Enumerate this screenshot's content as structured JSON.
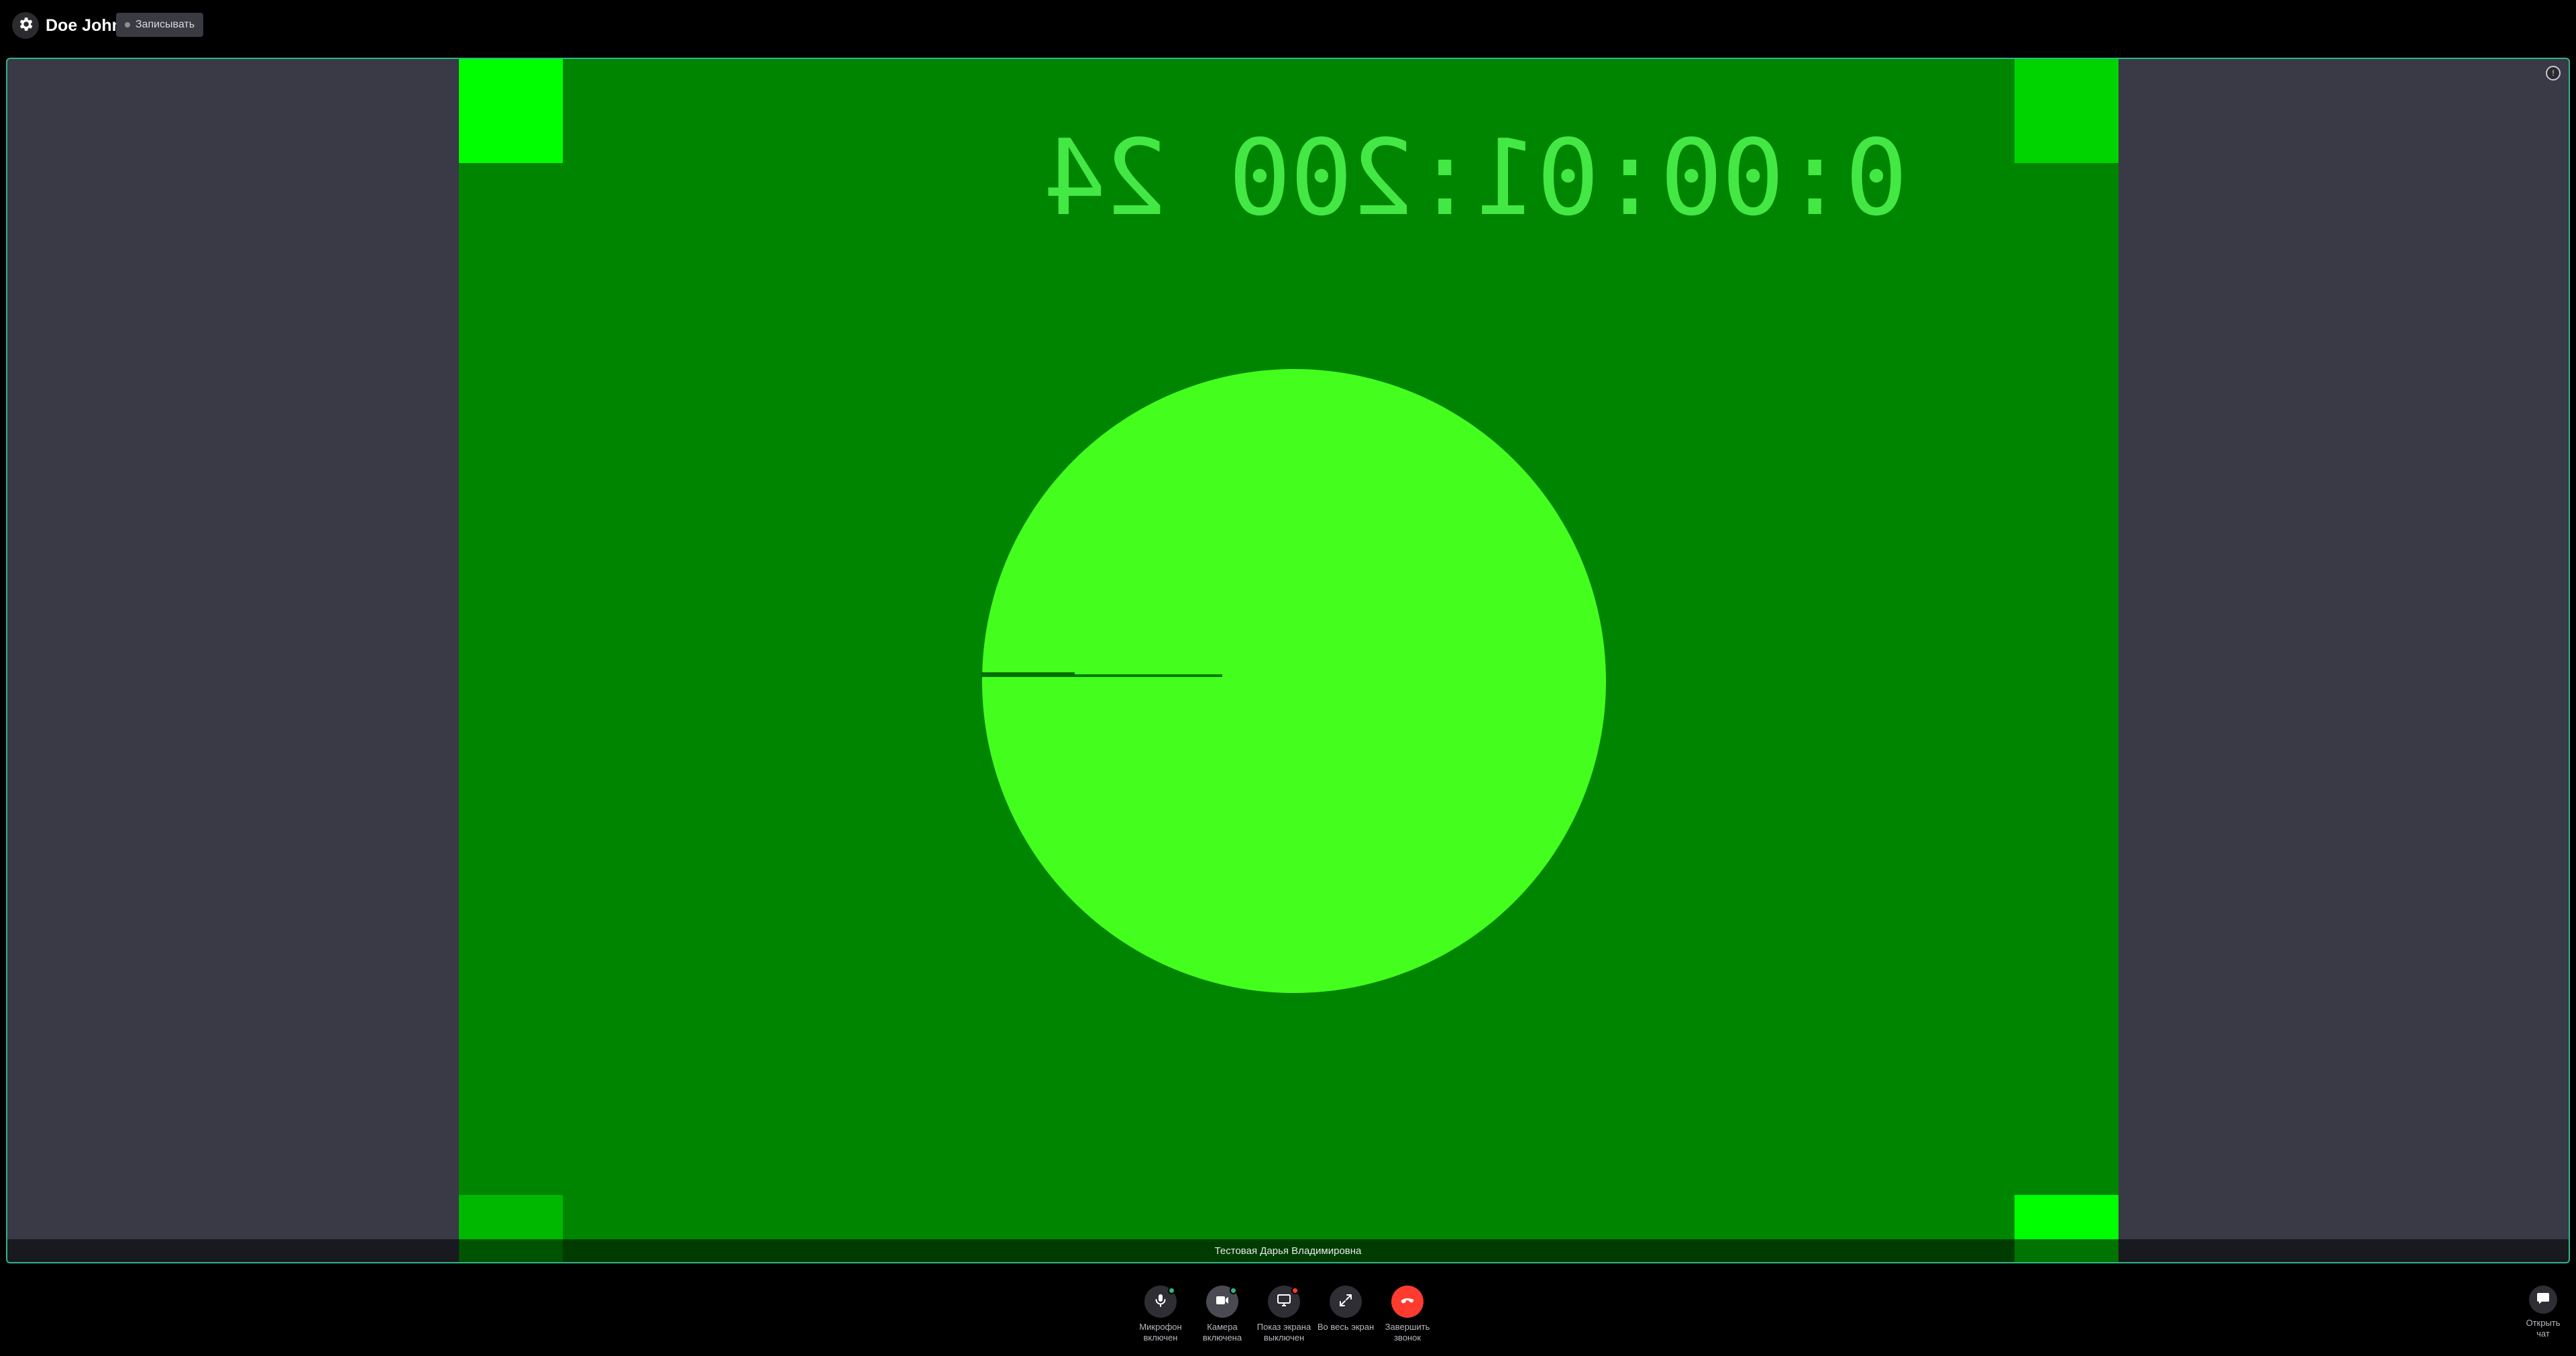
{
  "header": {
    "user_name": "Doe John",
    "record_label": "Записывать",
    "settings_icon": "gear-icon"
  },
  "video": {
    "timecode": "0:00:01:200 24",
    "participant_name": "Тестовая Дарья Владимировна",
    "tile_menu_icon": "info-icon",
    "colors": {
      "tile_background": "#393a45",
      "tile_border": "#2fb58a",
      "frame_green": "#008500",
      "circle_green": "#44ff1d"
    }
  },
  "controls": {
    "microphone": {
      "label": "Микрофон включен",
      "icon": "microphone-icon",
      "status_color": "#2fb58a"
    },
    "camera": {
      "label": "Камера включена",
      "icon": "camera-icon",
      "status_color": "#2fb58a"
    },
    "screen_share": {
      "label": "Показ экрана выключен",
      "icon": "screen-share-icon",
      "status_color": "#ff3b30"
    },
    "fullscreen": {
      "label": "Во весь экран",
      "icon": "expand-icon"
    },
    "hangup": {
      "label": "Завершить звонок",
      "icon": "phone-hangup-icon",
      "color": "#ff3b30"
    },
    "chat": {
      "label": "Открыть чат",
      "icon": "chat-icon"
    }
  }
}
